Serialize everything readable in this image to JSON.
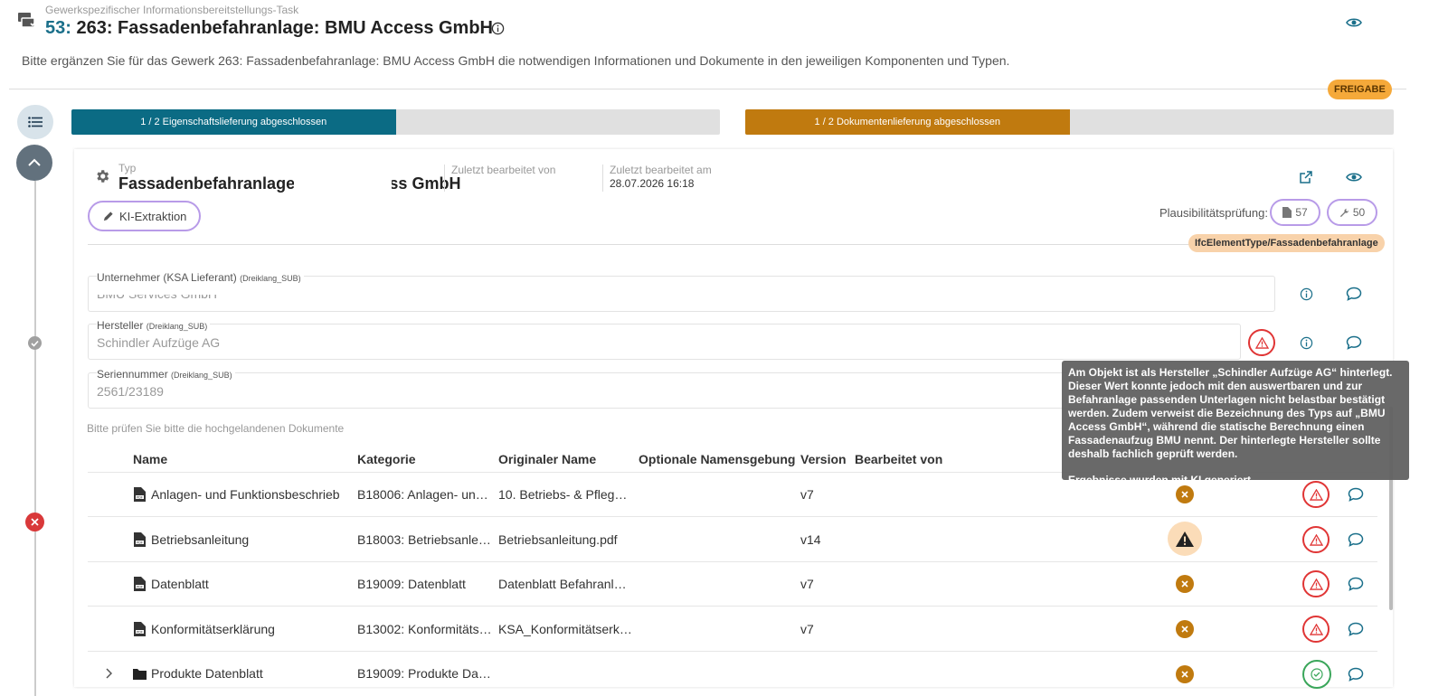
{
  "header": {
    "task_label": "Gewerkspezifischer Informationsbereitstellungs-Task",
    "task_number": "53:",
    "title": "263: Fassadenbefahranlage: BMU Access GmbH",
    "description": "Bitte ergänzen Sie für das Gewerk 263: Fassadenbefahranlage: BMU Access GmbH die notwendigen Informationen und Dokumente in den jeweiligen Komponenten und Typen.",
    "status_badge": "FREIGABE"
  },
  "progress": {
    "properties": {
      "label": "1 / 2 Eigenschaftslieferung abgeschlossen",
      "fraction": 0.5,
      "color": "#0b6b84"
    },
    "documents": {
      "label": "1 / 2 Dokumentenlieferung abgeschlossen",
      "fraction": 0.5,
      "color": "#c07a0f"
    }
  },
  "type_card": {
    "type_label": "Typ",
    "type_value": "Fassadenbefahranlage - BMU Access GmbH",
    "last_edited_by_label": "Zuletzt bearbeitet von",
    "last_edited_by_value": "",
    "last_edited_at_label": "Zuletzt bearbeitet am",
    "last_edited_at_value": "28.07.2026 16:18",
    "ki_button": "KI-Extraktion",
    "plausibility_label": "Plausibilitätsprüfung:",
    "plausibility_docs": "57",
    "plausibility_props": "50",
    "ifc_badge": "IfcElementType/Fassadenbefahranlage"
  },
  "fields": [
    {
      "label": "Unternehmer (KSA Lieferant)",
      "tag": "(Dreiklang_SUB)",
      "value": "BMU Services GmbH"
    },
    {
      "label": "Hersteller",
      "tag": "(Dreiklang_SUB)",
      "value": "Schindler Aufzüge AG"
    },
    {
      "label": "Seriennummer",
      "tag": "(Dreiklang_SUB)",
      "value": "2561/23189"
    }
  ],
  "documents_hint": "Bitte prüfen Sie bitte die hochgelandenen Dokumente",
  "table": {
    "columns": [
      "Name",
      "Kategorie",
      "Originaler Name",
      "Optionale Namensgebung",
      "Version",
      "Bearbeitet von"
    ],
    "rows": [
      {
        "name": "Anlagen- und Funktionsbeschrieb",
        "category": "B18006: Anlagen- und…",
        "original": "10. Betriebs- & Pflege…",
        "optional": "",
        "version": "v7",
        "editor": ""
      },
      {
        "name": "Betriebsanleitung",
        "category": "B18003: Betriebsanlei…",
        "original": "Betriebsanleitung.pdf",
        "optional": "",
        "version": "v14",
        "editor": ""
      },
      {
        "name": "Datenblatt",
        "category": "B19009: Datenblatt",
        "original": "Datenblatt Befahranla…",
        "optional": "",
        "version": "v7",
        "editor": ""
      },
      {
        "name": "Konformitätserklärung",
        "category": "B13002: Konformitäts…",
        "original": "KSA_Konformitätserk…",
        "optional": "",
        "version": "v7",
        "editor": ""
      },
      {
        "name": "Produkte Datenblatt",
        "category": "B19009: Produkte Dat…",
        "original": "",
        "optional": "",
        "version": "",
        "editor": ""
      }
    ]
  },
  "tooltip": {
    "text": "Am Objekt ist als Hersteller „Schindler Aufzüge AG“ hinterlegt. Dieser Wert konnte jedoch mit den auswertbaren und zur Befahranlage passenden Unterlagen nicht belastbar bestätigt werden. Zudem verweist die Bezeichnung des Typs auf „BMU Access GmbH“, während die statische Berechnung einen Fassadenaufzug BMU nennt. Der hinterlegte Hersteller sollte deshalb fachlich geprüft werden.",
    "generated_note": "Ergebnisse wurden mit KI generiert"
  },
  "icons": {
    "task": "task-stack-icon",
    "info": "info-icon",
    "eye": "eye-icon",
    "list": "list-icon",
    "chevron_up": "chevron-up-icon",
    "gear": "gear-icon",
    "external": "external-link-icon",
    "pencil": "pencil-icon",
    "file": "file-icon",
    "wrench": "wrench-icon",
    "comment": "comment-icon",
    "warning": "warning-icon",
    "pdf": "pdf-file-icon",
    "folder": "folder-icon",
    "check": "check-icon",
    "close": "close-icon"
  }
}
